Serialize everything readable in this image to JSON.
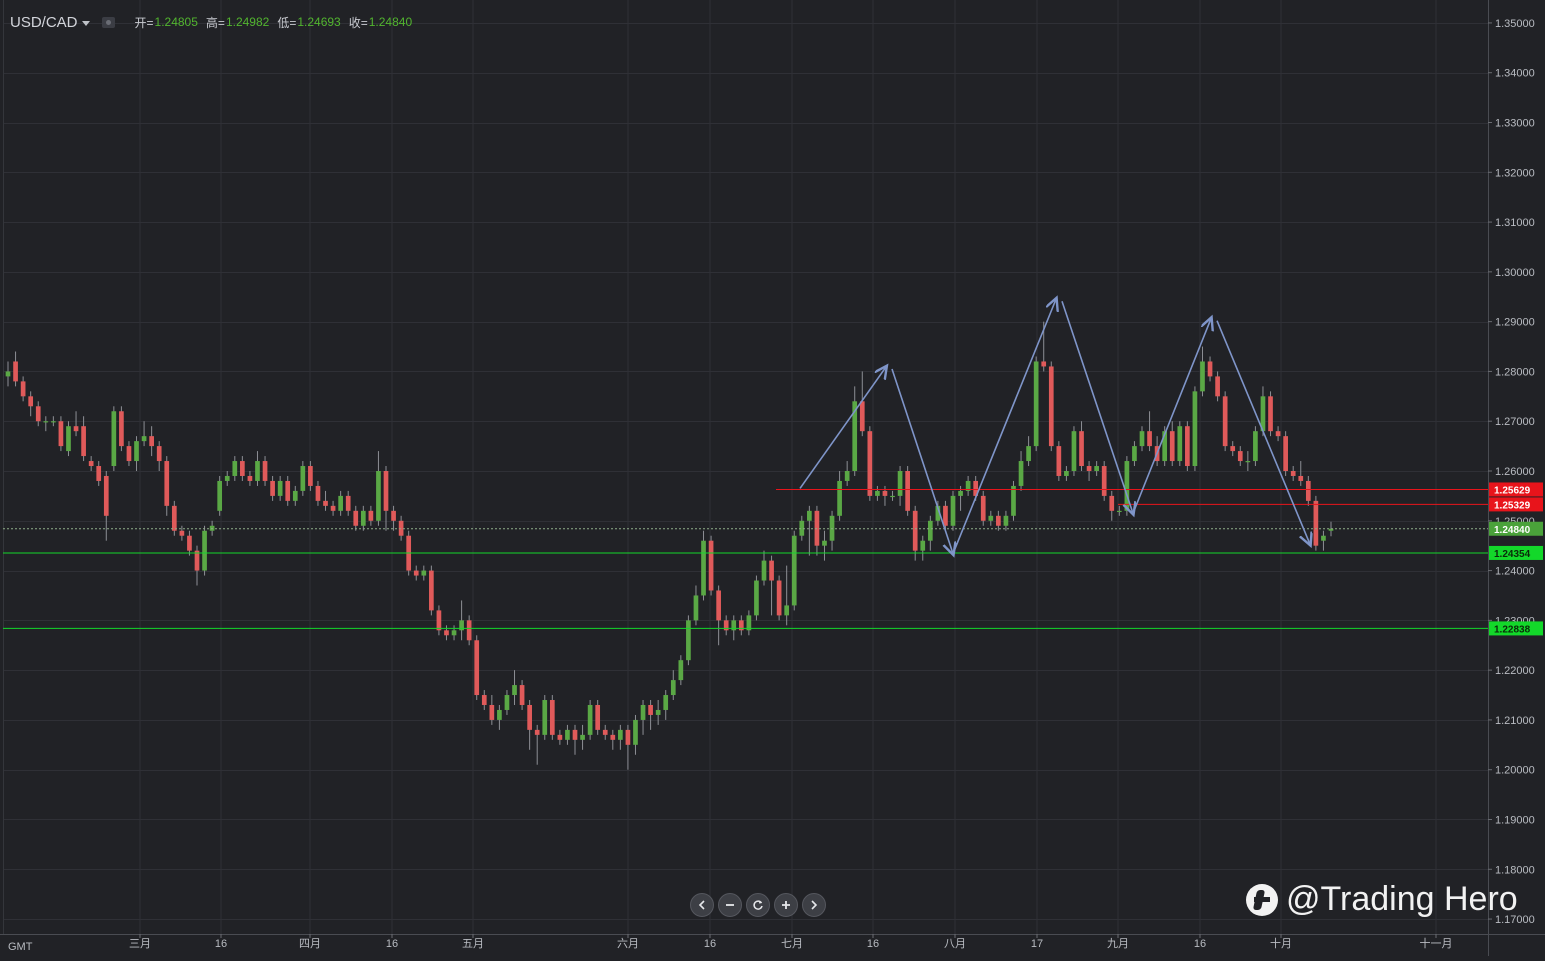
{
  "header": {
    "symbol": "USD/CAD",
    "ohlc": [
      {
        "label": "开=",
        "value": "1.24805"
      },
      {
        "label": "高=",
        "value": "1.24982"
      },
      {
        "label": "低=",
        "value": "1.24693"
      },
      {
        "label": "收=",
        "value": "1.24840"
      }
    ]
  },
  "timezone_label": "GMT",
  "watermark": "@Trading Hero",
  "nav_buttons": [
    {
      "name": "scroll-left-button",
      "icon": "chevron-left-icon"
    },
    {
      "name": "zoom-out-button",
      "icon": "minus-icon"
    },
    {
      "name": "reset-button",
      "icon": "refresh-icon"
    },
    {
      "name": "zoom-in-button",
      "icon": "plus-icon"
    },
    {
      "name": "scroll-right-button",
      "icon": "chevron-right-icon"
    }
  ],
  "colors": {
    "background": "#212226",
    "grid": "#2f3036",
    "up": "#5aa845",
    "down": "#e05a5a",
    "resistance": "#e8141b",
    "support": "#13d82a",
    "arrow": "#7f95c9",
    "current_price_line": "#8fae8a"
  },
  "chart_data": {
    "type": "candlestick",
    "symbol": "USD/CAD",
    "y_range": [
      1.167,
      1.353
    ],
    "y_ticks": [
      "1.35000",
      "1.34000",
      "1.33000",
      "1.32000",
      "1.31000",
      "1.30000",
      "1.29000",
      "1.28000",
      "1.27000",
      "1.26000",
      "1.25000",
      "1.24000",
      "1.23000",
      "1.22000",
      "1.21000",
      "1.20000",
      "1.19000",
      "1.18000",
      "1.17000"
    ],
    "x_ticks": [
      "三月",
      "16",
      "四月",
      "16",
      "五月",
      "六月",
      "16",
      "七月",
      "16",
      "八月",
      "17",
      "九月",
      "16",
      "十月",
      "十一月"
    ],
    "horizontal_levels": [
      {
        "price": 1.25629,
        "label": "1.25629",
        "kind": "resistance",
        "from": 0.5
      },
      {
        "price": 1.25329,
        "label": "1.25329",
        "kind": "resistance",
        "from": 0.722
      },
      {
        "price": 1.24354,
        "label": "1.24354",
        "kind": "support",
        "from": 0.0
      },
      {
        "price": 1.22838,
        "label": "1.22838",
        "kind": "support",
        "from": 0.0
      }
    ],
    "current_price": {
      "price": 1.2484,
      "label": "1.24840"
    },
    "arrow_path": [
      [
        1.2565,
        1.2809,
        1.2434,
        1.2945,
        1.2515,
        1.2906,
        1.2453
      ]
    ],
    "candles": [
      [
        1.279,
        1.28,
        1.277,
        1.282
      ],
      [
        1.282,
        1.278,
        1.277,
        1.284
      ],
      [
        1.278,
        1.275,
        1.274,
        1.279
      ],
      [
        1.275,
        1.273,
        1.271,
        1.276
      ],
      [
        1.273,
        1.27,
        1.269,
        1.274
      ],
      [
        1.27,
        1.27,
        1.268,
        1.271
      ],
      [
        1.27,
        1.27,
        1.269,
        1.271
      ],
      [
        1.27,
        1.265,
        1.264,
        1.271
      ],
      [
        1.264,
        1.269,
        1.263,
        1.27
      ],
      [
        1.269,
        1.268,
        1.267,
        1.272
      ],
      [
        1.269,
        1.263,
        1.262,
        1.271
      ],
      [
        1.262,
        1.261,
        1.26,
        1.263
      ],
      [
        1.261,
        1.258,
        1.257,
        1.262
      ],
      [
        1.259,
        1.251,
        1.246,
        1.26
      ],
      [
        1.261,
        1.272,
        1.26,
        1.273
      ],
      [
        1.272,
        1.265,
        1.264,
        1.273
      ],
      [
        1.265,
        1.262,
        1.261,
        1.266
      ],
      [
        1.262,
        1.266,
        1.26,
        1.267
      ],
      [
        1.266,
        1.267,
        1.265,
        1.27
      ],
      [
        1.267,
        1.265,
        1.263,
        1.269
      ],
      [
        1.265,
        1.262,
        1.26,
        1.266
      ],
      [
        1.262,
        1.253,
        1.251,
        1.263
      ],
      [
        1.253,
        1.248,
        1.247,
        1.254
      ],
      [
        1.248,
        1.247,
        1.246,
        1.249
      ],
      [
        1.247,
        1.244,
        1.243,
        1.248
      ],
      [
        1.244,
        1.24,
        1.237,
        1.245
      ],
      [
        1.24,
        1.248,
        1.239,
        1.249
      ],
      [
        1.248,
        1.249,
        1.247,
        1.25
      ],
      [
        1.252,
        1.258,
        1.251,
        1.259
      ],
      [
        1.258,
        1.259,
        1.257,
        1.26
      ],
      [
        1.259,
        1.262,
        1.258,
        1.263
      ],
      [
        1.262,
        1.259,
        1.258,
        1.263
      ],
      [
        1.259,
        1.258,
        1.257,
        1.26
      ],
      [
        1.258,
        1.262,
        1.257,
        1.264
      ],
      [
        1.262,
        1.258,
        1.257,
        1.263
      ],
      [
        1.258,
        1.255,
        1.254,
        1.259
      ],
      [
        1.255,
        1.258,
        1.254,
        1.259
      ],
      [
        1.258,
        1.254,
        1.253,
        1.259
      ],
      [
        1.254,
        1.256,
        1.253,
        1.257
      ],
      [
        1.256,
        1.261,
        1.255,
        1.262
      ],
      [
        1.261,
        1.257,
        1.256,
        1.262
      ],
      [
        1.257,
        1.254,
        1.253,
        1.258
      ],
      [
        1.254,
        1.253,
        1.252,
        1.256
      ],
      [
        1.253,
        1.252,
        1.251,
        1.254
      ],
      [
        1.252,
        1.255,
        1.251,
        1.256
      ],
      [
        1.255,
        1.252,
        1.251,
        1.256
      ],
      [
        1.252,
        1.249,
        1.248,
        1.253
      ],
      [
        1.249,
        1.252,
        1.248,
        1.253
      ],
      [
        1.252,
        1.25,
        1.249,
        1.253
      ],
      [
        1.25,
        1.26,
        1.249,
        1.264
      ],
      [
        1.26,
        1.252,
        1.248,
        1.261
      ],
      [
        1.252,
        1.25,
        1.248,
        1.253
      ],
      [
        1.25,
        1.247,
        1.246,
        1.251
      ],
      [
        1.247,
        1.24,
        1.239,
        1.248
      ],
      [
        1.24,
        1.239,
        1.238,
        1.241
      ],
      [
        1.239,
        1.24,
        1.238,
        1.241
      ],
      [
        1.24,
        1.232,
        1.231,
        1.241
      ],
      [
        1.232,
        1.228,
        1.227,
        1.233
      ],
      [
        1.228,
        1.227,
        1.226,
        1.229
      ],
      [
        1.227,
        1.228,
        1.226,
        1.229
      ],
      [
        1.228,
        1.23,
        1.226,
        1.234
      ],
      [
        1.23,
        1.226,
        1.225,
        1.231
      ],
      [
        1.226,
        1.215,
        1.214,
        1.227
      ],
      [
        1.215,
        1.213,
        1.212,
        1.216
      ],
      [
        1.213,
        1.21,
        1.209,
        1.215
      ],
      [
        1.21,
        1.212,
        1.208,
        1.213
      ],
      [
        1.212,
        1.215,
        1.211,
        1.216
      ],
      [
        1.215,
        1.217,
        1.213,
        1.22
      ],
      [
        1.217,
        1.213,
        1.212,
        1.218
      ],
      [
        1.213,
        1.208,
        1.204,
        1.214
      ],
      [
        1.208,
        1.207,
        1.201,
        1.209
      ],
      [
        1.207,
        1.214,
        1.206,
        1.215
      ],
      [
        1.214,
        1.207,
        1.206,
        1.215
      ],
      [
        1.207,
        1.206,
        1.205,
        1.208
      ],
      [
        1.206,
        1.208,
        1.205,
        1.209
      ],
      [
        1.208,
        1.206,
        1.203,
        1.209
      ],
      [
        1.206,
        1.207,
        1.204,
        1.209
      ],
      [
        1.207,
        1.213,
        1.206,
        1.214
      ],
      [
        1.213,
        1.208,
        1.207,
        1.214
      ],
      [
        1.208,
        1.207,
        1.206,
        1.209
      ],
      [
        1.207,
        1.206,
        1.204,
        1.208
      ],
      [
        1.206,
        1.208,
        1.204,
        1.209
      ],
      [
        1.208,
        1.205,
        1.2,
        1.209
      ],
      [
        1.205,
        1.21,
        1.203,
        1.211
      ],
      [
        1.21,
        1.213,
        1.207,
        1.214
      ],
      [
        1.213,
        1.211,
        1.208,
        1.214
      ],
      [
        1.211,
        1.212,
        1.209,
        1.214
      ],
      [
        1.212,
        1.215,
        1.21,
        1.216
      ],
      [
        1.215,
        1.218,
        1.214,
        1.22
      ],
      [
        1.218,
        1.222,
        1.217,
        1.223
      ],
      [
        1.222,
        1.23,
        1.221,
        1.231
      ],
      [
        1.23,
        1.235,
        1.229,
        1.237
      ],
      [
        1.235,
        1.246,
        1.234,
        1.248
      ],
      [
        1.246,
        1.236,
        1.235,
        1.247
      ],
      [
        1.236,
        1.23,
        1.225,
        1.237
      ],
      [
        1.23,
        1.228,
        1.227,
        1.231
      ],
      [
        1.228,
        1.23,
        1.226,
        1.231
      ],
      [
        1.23,
        1.228,
        1.227,
        1.231
      ],
      [
        1.228,
        1.231,
        1.227,
        1.232
      ],
      [
        1.231,
        1.238,
        1.23,
        1.239
      ],
      [
        1.238,
        1.242,
        1.237,
        1.244
      ],
      [
        1.242,
        1.238,
        1.231,
        1.243
      ],
      [
        1.238,
        1.231,
        1.23,
        1.239
      ],
      [
        1.231,
        1.233,
        1.229,
        1.241
      ],
      [
        1.233,
        1.247,
        1.232,
        1.248
      ],
      [
        1.247,
        1.25,
        1.246,
        1.251
      ],
      [
        1.25,
        1.252,
        1.243,
        1.253
      ],
      [
        1.252,
        1.245,
        1.243,
        1.253
      ],
      [
        1.245,
        1.246,
        1.242,
        1.248
      ],
      [
        1.246,
        1.251,
        1.244,
        1.252
      ],
      [
        1.251,
        1.258,
        1.25,
        1.26
      ],
      [
        1.258,
        1.26,
        1.257,
        1.262
      ],
      [
        1.26,
        1.274,
        1.259,
        1.277
      ],
      [
        1.274,
        1.268,
        1.267,
        1.28
      ],
      [
        1.268,
        1.255,
        1.254,
        1.269
      ],
      [
        1.255,
        1.256,
        1.254,
        1.257
      ],
      [
        1.256,
        1.255,
        1.253,
        1.257
      ],
      [
        1.255,
        1.255,
        1.254,
        1.256
      ],
      [
        1.255,
        1.26,
        1.253,
        1.261
      ],
      [
        1.26,
        1.252,
        1.251,
        1.261
      ],
      [
        1.252,
        1.244,
        1.242,
        1.253
      ],
      [
        1.244,
        1.246,
        1.242,
        1.247
      ],
      [
        1.246,
        1.25,
        1.244,
        1.251
      ],
      [
        1.25,
        1.253,
        1.249,
        1.254
      ],
      [
        1.253,
        1.249,
        1.248,
        1.254
      ],
      [
        1.249,
        1.255,
        1.248,
        1.256
      ],
      [
        1.255,
        1.256,
        1.252,
        1.257
      ],
      [
        1.256,
        1.258,
        1.255,
        1.259
      ],
      [
        1.258,
        1.255,
        1.254,
        1.259
      ],
      [
        1.255,
        1.25,
        1.249,
        1.256
      ],
      [
        1.25,
        1.251,
        1.249,
        1.252
      ],
      [
        1.251,
        1.249,
        1.248,
        1.252
      ],
      [
        1.249,
        1.251,
        1.248,
        1.252
      ],
      [
        1.251,
        1.257,
        1.25,
        1.258
      ],
      [
        1.257,
        1.262,
        1.256,
        1.264
      ],
      [
        1.262,
        1.265,
        1.261,
        1.267
      ],
      [
        1.265,
        1.282,
        1.264,
        1.283
      ],
      [
        1.282,
        1.281,
        1.28,
        1.29
      ],
      [
        1.281,
        1.265,
        1.264,
        1.282
      ],
      [
        1.265,
        1.259,
        1.258,
        1.266
      ],
      [
        1.259,
        1.26,
        1.258,
        1.261
      ],
      [
        1.26,
        1.268,
        1.259,
        1.269
      ],
      [
        1.268,
        1.261,
        1.26,
        1.27
      ],
      [
        1.261,
        1.26,
        1.258,
        1.262
      ],
      [
        1.26,
        1.261,
        1.259,
        1.262
      ],
      [
        1.261,
        1.255,
        1.254,
        1.262
      ],
      [
        1.255,
        1.252,
        1.25,
        1.256
      ],
      [
        1.252,
        1.252,
        1.251,
        1.253
      ],
      [
        1.252,
        1.262,
        1.251,
        1.263
      ],
      [
        1.262,
        1.265,
        1.261,
        1.266
      ],
      [
        1.265,
        1.268,
        1.264,
        1.269
      ],
      [
        1.268,
        1.265,
        1.264,
        1.272
      ],
      [
        1.265,
        1.262,
        1.261,
        1.267
      ],
      [
        1.262,
        1.268,
        1.261,
        1.269
      ],
      [
        1.268,
        1.262,
        1.261,
        1.27
      ],
      [
        1.262,
        1.269,
        1.261,
        1.27
      ],
      [
        1.269,
        1.261,
        1.26,
        1.27
      ],
      [
        1.261,
        1.276,
        1.26,
        1.277
      ],
      [
        1.276,
        1.282,
        1.275,
        1.285
      ],
      [
        1.282,
        1.279,
        1.278,
        1.283
      ],
      [
        1.279,
        1.275,
        1.274,
        1.28
      ],
      [
        1.275,
        1.265,
        1.264,
        1.276
      ],
      [
        1.265,
        1.264,
        1.263,
        1.266
      ],
      [
        1.264,
        1.262,
        1.261,
        1.265
      ],
      [
        1.262,
        1.262,
        1.26,
        1.264
      ],
      [
        1.262,
        1.268,
        1.261,
        1.269
      ],
      [
        1.268,
        1.275,
        1.267,
        1.277
      ],
      [
        1.275,
        1.268,
        1.267,
        1.276
      ],
      [
        1.268,
        1.267,
        1.266,
        1.269
      ],
      [
        1.267,
        1.26,
        1.259,
        1.268
      ],
      [
        1.26,
        1.259,
        1.258,
        1.261
      ],
      [
        1.259,
        1.258,
        1.257,
        1.262
      ],
      [
        1.258,
        1.254,
        1.253,
        1.259
      ],
      [
        1.254,
        1.245,
        1.244,
        1.255
      ],
      [
        1.246,
        1.247,
        1.244,
        1.248
      ],
      [
        1.248,
        1.2484,
        1.2469,
        1.2498
      ]
    ]
  }
}
